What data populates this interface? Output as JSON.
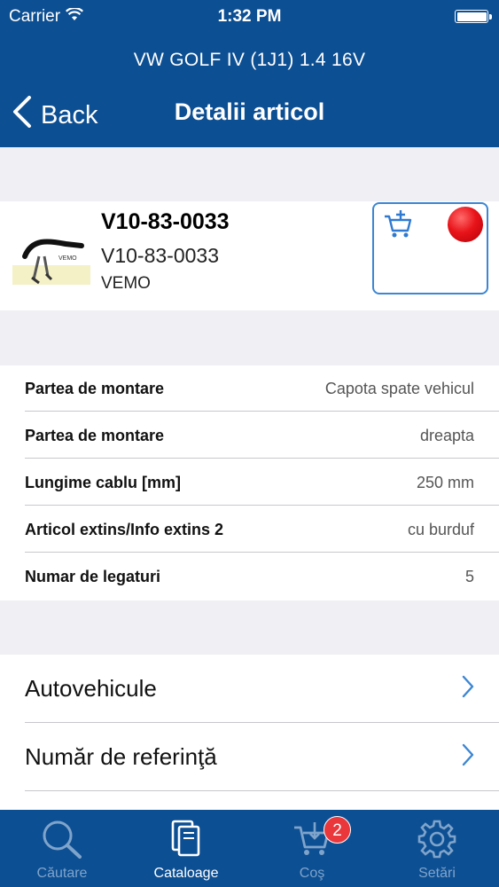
{
  "status_bar": {
    "carrier": "Carrier",
    "time": "1:32 PM"
  },
  "header": {
    "vehicle": "VW GOLF IV (1J1) 1.4 16V",
    "back_label": "Back",
    "title": "Detalii articol"
  },
  "product": {
    "article_number": "V10-83-0033",
    "article_sub": "V10-83-0033",
    "brand": "VEMO",
    "thumbnail_text": "VEMO",
    "stock_status_color": "#e8141a"
  },
  "specs": [
    {
      "label": "Partea de montare",
      "value": "Capota spate vehicul"
    },
    {
      "label": "Partea de montare",
      "value": "dreapta"
    },
    {
      "label": "Lungime cablu [mm]",
      "value": "250 mm"
    },
    {
      "label": "Articol extins/Info extins 2",
      "value": "cu burduf"
    },
    {
      "label": "Numar de legaturi",
      "value": "5"
    }
  ],
  "links": [
    {
      "label": "Autovehicule"
    },
    {
      "label": "Număr de referinţă"
    }
  ],
  "tabbar": {
    "tabs": [
      {
        "label": "Căutare",
        "icon": "search-icon"
      },
      {
        "label": "Cataloage",
        "icon": "catalog-icon"
      },
      {
        "label": "Coş",
        "icon": "cart-icon"
      },
      {
        "label": "Setări",
        "icon": "gear-icon"
      }
    ],
    "active_tab": "Cataloage",
    "cart_badge": "2"
  },
  "colors": {
    "primary": "#0d4f93",
    "accent": "#3c86d3",
    "badge": "#e9373c"
  }
}
